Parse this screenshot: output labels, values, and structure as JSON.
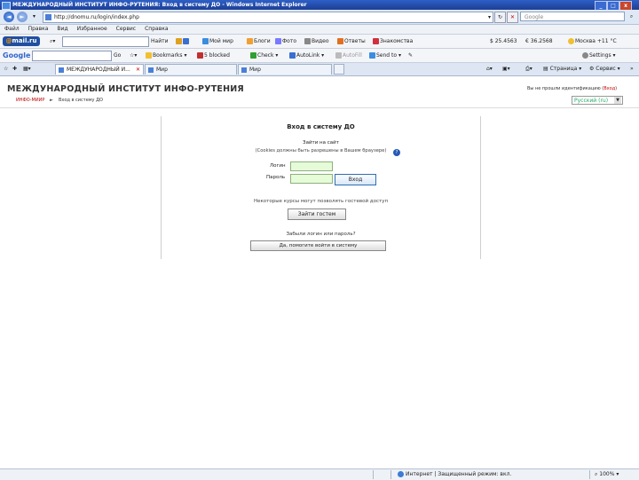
{
  "window": {
    "title": "МЕЖДУНАРОДНЫЙ ИНСТИТУТ ИНФО-РУТЕНИЯ: Вход в систему ДО - Windows Internet Explorer",
    "controls": [
      "_",
      "□",
      "x"
    ]
  },
  "addressbar": {
    "url": "http://dnomu.ru/login/index.php",
    "search_placeholder": "Google"
  },
  "menu": [
    "Файл",
    "Правка",
    "Вид",
    "Избранное",
    "Сервис",
    "Справка"
  ],
  "mail_toolbar": {
    "logo_prefix": "@",
    "logo_text": "mail.ru",
    "search_label": "Найти",
    "items": [
      "Мой мир",
      "Блоги",
      "Фото",
      "Видео",
      "Ответы",
      "Знакомства"
    ],
    "currency1": "$ 25.4563",
    "currency2": "€ 36.2568",
    "weather": "Москва +11 °C"
  },
  "google_toolbar": {
    "logo": "Google",
    "go_label": "Go",
    "items": [
      "Bookmarks",
      "5 blocked",
      "Check",
      "AutoLink",
      "AutoFill",
      "Send to"
    ],
    "settings": "Settings"
  },
  "tabs": [
    {
      "label": "МЕЖДУНАРОДНЫЙ И..."
    },
    {
      "label": "Мир"
    },
    {
      "label": "Мир"
    }
  ],
  "commandbar": {
    "page": "Страница",
    "tools": "Сервис"
  },
  "page": {
    "site_title": "МЕЖДУНАРОДНЫЙ ИНСТИТУТ ИНФО-РУТЕНИЯ",
    "login_status_prefix": "Вы не прошли идентификацию (",
    "login_status_link": "Вход",
    "login_status_suffix": ")",
    "breadcrumb_home": "ИНФО-МИИР",
    "breadcrumb_sep": "►",
    "breadcrumb_current": "Вход в систему ДО",
    "language": "Русский (ru)",
    "heading": "Вход в систему ДО",
    "subheading": "Зайти на сайт",
    "cookie_note": "(Cookies должны быть разрешены в Вашем браузере)",
    "username_label": "Логин",
    "password_label": "Пароль",
    "login_button": "Вход",
    "guest_note": "Некоторые курсы могут позволять гостевой доступ",
    "guest_button": "Зайти гостем",
    "forgot_text": "Забыли логин или пароль?",
    "forgot_button": "Да, помогите войти в систему"
  },
  "statusbar": {
    "zone": "Интернет | Защищенный режим: вкл.",
    "zoom": "100%"
  }
}
